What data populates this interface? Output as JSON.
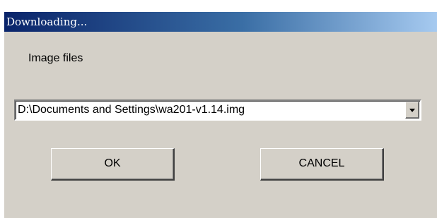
{
  "window": {
    "title": "Downloading..."
  },
  "dialog": {
    "label": "Image files",
    "file_path": "D:\\Documents and Settings\\wa201-v1.14.img"
  },
  "buttons": {
    "ok_label": "OK",
    "cancel_label": "CANCEL"
  },
  "icons": {
    "dropdown": "chevron-down-icon"
  },
  "colors": {
    "titlebar_start": "#0a246a",
    "titlebar_end": "#a6caf0",
    "dialog_background": "#d4d0c8"
  }
}
